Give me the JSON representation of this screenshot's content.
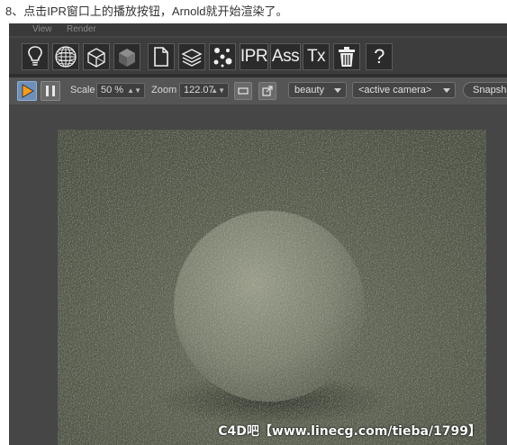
{
  "caption": "8、点击IPR窗口上的播放按钮，Arnold就开始渲染了。",
  "menu": {
    "view": "View",
    "render": "Render"
  },
  "toolbar_top": {
    "icons": [
      "light-bulb-icon",
      "wireframe-sphere-icon",
      "wireframe-cube-icon",
      "shaded-cube-icon",
      "document-icon",
      "layers-icon",
      "particles-icon"
    ],
    "ipr_label": "IPR",
    "ass_label": "Ass",
    "tx_label": "Tx",
    "delete_icon": "trash-icon",
    "help_label": "?"
  },
  "toolbar_ipr": {
    "play_icon": "play-icon",
    "pause_icon": "pause-icon",
    "scale_label": "Scale",
    "scale_value": "50 %",
    "zoom_label": "Zoom",
    "zoom_value": "122.07",
    "aov_value": "beauty",
    "camera_value": "<active camera>",
    "snapshot_label": "Snapsh",
    "colors": {
      "play_active_bg": "#6f8fb8",
      "play_glyph": "#f39c1f"
    }
  },
  "render_view": {
    "watermark": "C4D吧【www.linecg.com/tieba/1799】",
    "colors": {
      "floor": "#5e6452",
      "sphere": "#8a8f7c"
    }
  }
}
